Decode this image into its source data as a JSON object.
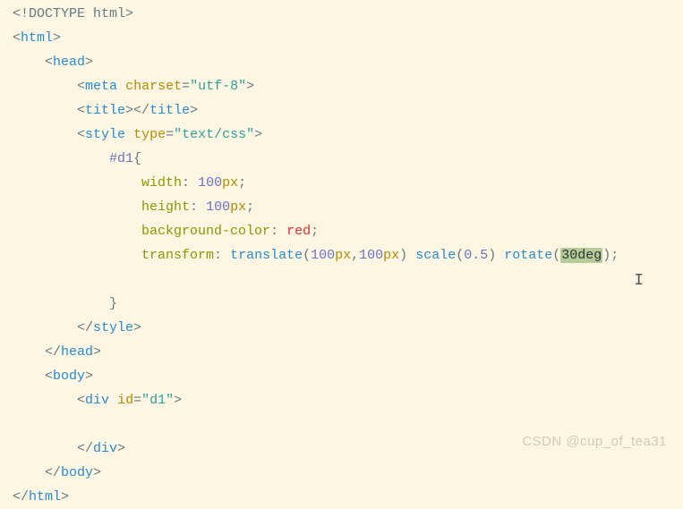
{
  "code": {
    "doctype": "<!DOCTYPE html>",
    "html_open": "html",
    "head_open": "head",
    "meta_tag": "meta",
    "meta_attr": "charset",
    "meta_val": "\"utf-8\"",
    "title_tag": "title",
    "style_tag": "style",
    "style_attr": "type",
    "style_val": "\"text/css\"",
    "selector": "#d1",
    "brace_open": "{",
    "prop_width": "width",
    "val_100": "100",
    "unit_px": "px",
    "prop_height": "height",
    "prop_bg": "background-color",
    "val_red": "red",
    "prop_transform": "transform",
    "func_translate": "translate",
    "func_scale": "scale",
    "val_05": "0.5",
    "func_rotate": "rotate",
    "val_30deg": "30deg",
    "brace_close": "}",
    "style_close": "style",
    "head_close": "head",
    "body_open": "body",
    "div_tag": "div",
    "div_attr": "id",
    "div_val": "\"d1\"",
    "div_close": "div",
    "body_close": "body",
    "html_close": "html"
  },
  "watermark": "CSDN @cup_of_tea31"
}
